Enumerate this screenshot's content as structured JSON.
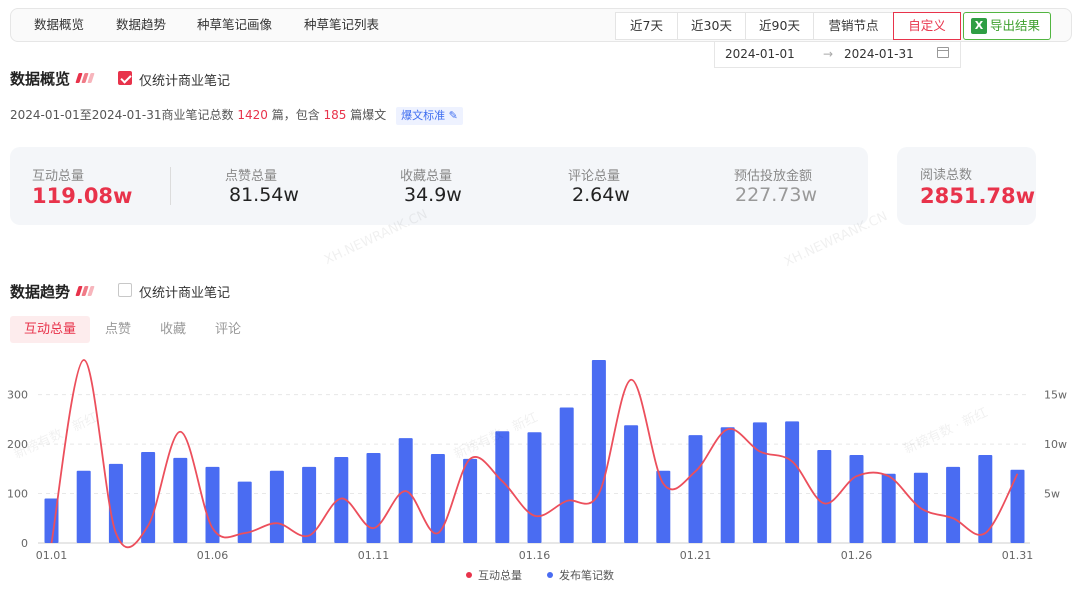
{
  "nav": {
    "tabs": [
      "数据概览",
      "数据趋势",
      "种草笔记画像",
      "种草笔记列表"
    ],
    "ranges": [
      "近7天",
      "近30天",
      "近90天",
      "营销节点",
      "自定义"
    ],
    "active_range": "自定义",
    "export_label": "导出结果",
    "date_start": "2024-01-01",
    "date_end": "2024-01-31",
    "date_arrow": "→"
  },
  "overview": {
    "title": "数据概览",
    "checkbox_label": "仅统计商业笔记",
    "checkbox_checked": true,
    "summary": {
      "prefix": "2024-01-01至2024-01-31商业笔记总数",
      "total": "1420",
      "mid": "篇，包含",
      "burst": "185",
      "suffix": "篇爆文",
      "tag": "爆文标准"
    }
  },
  "stats": [
    {
      "label": "互动总量",
      "value": "119.08w"
    },
    {
      "label": "点赞总量",
      "value": "81.54w"
    },
    {
      "label": "收藏总量",
      "value": "34.9w"
    },
    {
      "label": "评论总量",
      "value": "2.64w"
    },
    {
      "label": "预估投放金额",
      "value": "227.73w"
    }
  ],
  "reads": {
    "label": "阅读总数",
    "value": "2851.78w"
  },
  "trend": {
    "title": "数据趋势",
    "checkbox_label": "仅统计商业笔记",
    "checkbox_checked": false,
    "tabs": [
      "互动总量",
      "点赞",
      "收藏",
      "评论"
    ],
    "active_tab": "互动总量"
  },
  "watermarks": [
    "XH.NEWRANK.CN",
    "XH.NEWRANK.CN",
    "新榜有数 · 新红",
    "新榜有数 · 新红",
    "新榜有数 · 新红"
  ],
  "colors": {
    "accent": "#e8334b",
    "bar": "#4a6cf2",
    "line": "#ec4f5c"
  },
  "chart_data": {
    "type": "bar",
    "x_ticks": [
      "01.01",
      "01.06",
      "01.11",
      "01.16",
      "01.21",
      "01.26",
      "01.31"
    ],
    "y_left_ticks": [
      "0",
      "100",
      "200",
      "300"
    ],
    "y_right_ticks": [
      "5w",
      "10w",
      "15w"
    ],
    "y_left_lim": [
      0,
      370
    ],
    "y_right_lim": [
      0,
      185000
    ],
    "legend_placement": "bottom",
    "days": [
      "01.01",
      "01.02",
      "01.03",
      "01.04",
      "01.05",
      "01.06",
      "01.07",
      "01.08",
      "01.09",
      "01.10",
      "01.11",
      "01.12",
      "01.13",
      "01.14",
      "01.15",
      "01.16",
      "01.17",
      "01.18",
      "01.19",
      "01.20",
      "01.21",
      "01.22",
      "01.23",
      "01.24",
      "01.25",
      "01.26",
      "01.27",
      "01.28",
      "01.29",
      "01.30",
      "01.31"
    ],
    "series": [
      {
        "name": "发布笔记数",
        "type": "bar",
        "axis": "right",
        "values": [
          45000,
          73000,
          80000,
          92000,
          86000,
          77000,
          62000,
          73000,
          77000,
          87000,
          91000,
          106000,
          90000,
          85000,
          113000,
          112000,
          137000,
          185000,
          119000,
          73000,
          109000,
          117000,
          122000,
          123000,
          94000,
          89000,
          70000,
          71000,
          77000,
          89000,
          74000
        ]
      },
      {
        "name": "互动总量",
        "type": "line",
        "axis": "left",
        "values": [
          0,
          370,
          20,
          35,
          225,
          30,
          20,
          40,
          15,
          90,
          30,
          105,
          20,
          170,
          125,
          55,
          85,
          100,
          330,
          120,
          145,
          230,
          185,
          165,
          80,
          135,
          135,
          70,
          50,
          20,
          140
        ]
      }
    ]
  }
}
